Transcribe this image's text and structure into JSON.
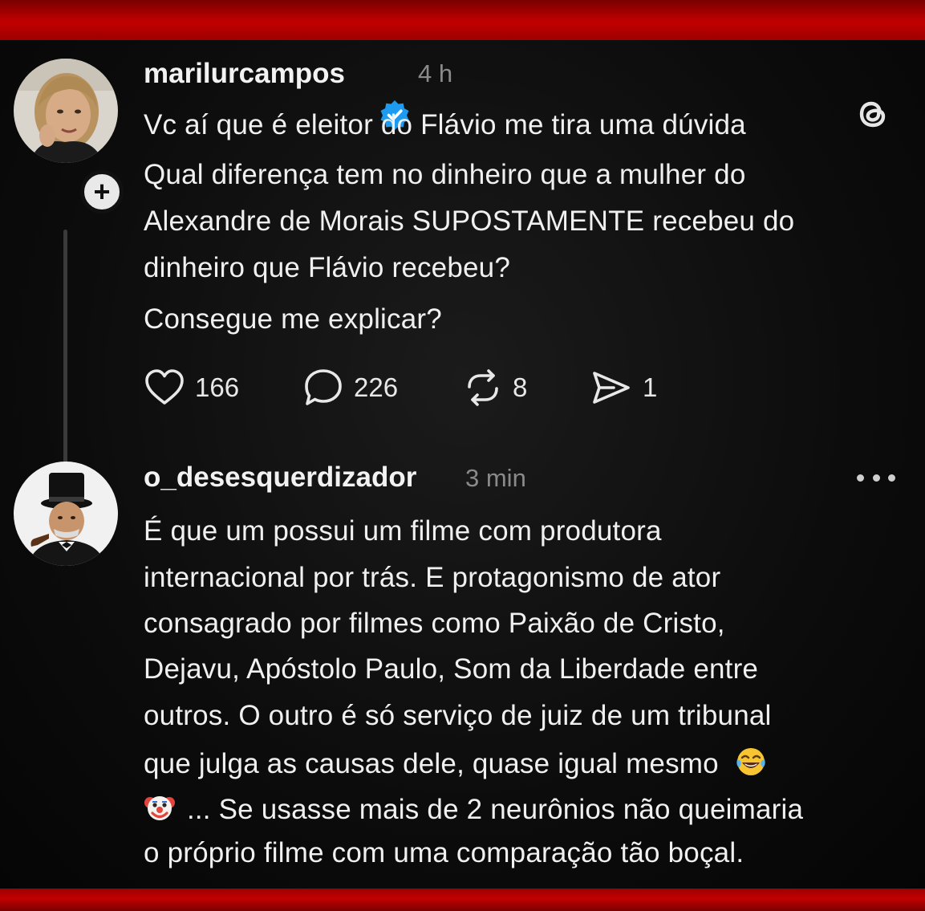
{
  "post": {
    "username": "marilurcampos",
    "time": "4 h",
    "lines": [
      "Vc aí que é eleitor do Flávio me tira uma dúvida",
      "Qual diferença tem no dinheiro que a mulher do",
      "Alexandre de Morais SUPOSTAMENTE recebeu do",
      "dinheiro que Flávio recebeu?",
      "Consegue me explicar?"
    ],
    "likes": "166",
    "replies": "226",
    "reposts": "8",
    "shares": "1"
  },
  "reply": {
    "username": "o_desesquerdizador",
    "time": "3 min",
    "lines": [
      "É que um possui um filme com produtora",
      "internacional por trás. E protagonismo de ator",
      "consagrado por filmes como Paixão de Cristo,",
      "Dejavu, Apóstolo Paulo, Som da Liberdade entre",
      "outros. O outro é só serviço de juiz de um tribunal",
      "que julga as causas dele, quase igual mesmo",
      "... Se usasse mais de 2 neurônios não queimaria",
      "o próprio filme com uma comparação tão boçal."
    ]
  },
  "icons": {
    "like": "heart-icon",
    "reply": "speech-bubble-icon",
    "repost": "repost-arrows-icon",
    "share": "send-icon",
    "verified": "verified-badge-icon",
    "threads": "threads-logo-icon",
    "more": "more-dots-icon",
    "follow": "plus-icon",
    "laugh": "tears-of-joy-emoji",
    "clown": "clown-face-emoji"
  },
  "colors": {
    "frame": "#c20000",
    "verified": "#1d9bf0",
    "muted": "#8a8a8a"
  }
}
